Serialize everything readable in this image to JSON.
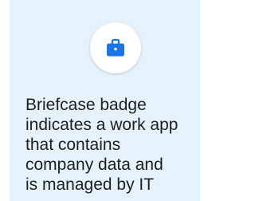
{
  "card": {
    "icon": "briefcase-icon",
    "background_color": "#e5f2fc",
    "icon_color": "#1a73e8",
    "caption_lines": [
      "Briefcase badge",
      "indicates a work app",
      "that contains",
      "company data and",
      "is managed by IT"
    ]
  }
}
